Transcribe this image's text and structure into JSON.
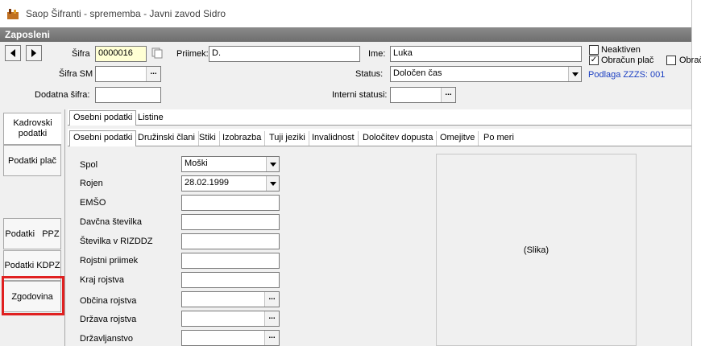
{
  "window": {
    "title": "Saop Šifranti - sprememba - Javni zavod Sidro"
  },
  "header": {
    "title": "Zaposleni"
  },
  "form": {
    "sifra_label": "Šifra",
    "sifra_value": "0000016",
    "priimek_label": "Priimek:",
    "priimek_value": "D.",
    "ime_label": "Ime:",
    "ime_value": "Luka",
    "sifra_sm_label": "Šifra SM",
    "sifra_sm_value": "",
    "dodatna_sifra_label": "Dodatna šifra:",
    "dodatna_sifra_value": "",
    "status_label": "Status:",
    "status_value": "Določen čas",
    "interni_status_label": "Interni statusi:",
    "interni_status_value": "",
    "neaktiven_label": "Neaktiven",
    "neaktiven_checked": false,
    "obracun_plac_label": "Obračun plač",
    "obracun_plac_checked": true,
    "obrac_label": "Obrač",
    "obrac_checked": false,
    "podlaga_label": "Podlaga ZZZS: 001",
    "ellipsis": "..."
  },
  "sidebar": {
    "items": [
      {
        "label_line1": "Kadrovski",
        "label_line2": "podatki"
      },
      {
        "label": "Podatki  plač"
      },
      {
        "label": "Podatki   PPZ"
      },
      {
        "label": "Podatki KDPZ"
      },
      {
        "label": "Zgodovina"
      }
    ]
  },
  "tabs_top": [
    "Osebni podatki",
    "Listine"
  ],
  "tabs_sub": [
    "Osebni podatki",
    "Družinski člani",
    "Stiki",
    "Izobrazba",
    "Tuji jeziki",
    "Invalidnost",
    "Določitev dopusta",
    "Omejitve",
    "Po meri"
  ],
  "personal": {
    "spol_label": "Spol",
    "spol_value": "Moški",
    "rojen_label": "Rojen",
    "rojen_value": "28.02.1999",
    "emso_label": "EMŠO",
    "davcna_label": "Davčna številka",
    "rizddz_label": "Številka v RIZDDZ",
    "rojstni_priimek_label": "Rojstni priimek",
    "kraj_rojstva_label": "Kraj rojstva",
    "obcina_rojstva_label": "Občina rojstva",
    "drzava_rojstva_label": "Država rojstva",
    "drzavljanstvo_label": "Državljanstvo",
    "photo_label": "(Slika)"
  },
  "colors": {
    "highlight_frame": "#e02020",
    "header_bg": "#7a7a7a",
    "link_blue": "#1a3ec2"
  }
}
